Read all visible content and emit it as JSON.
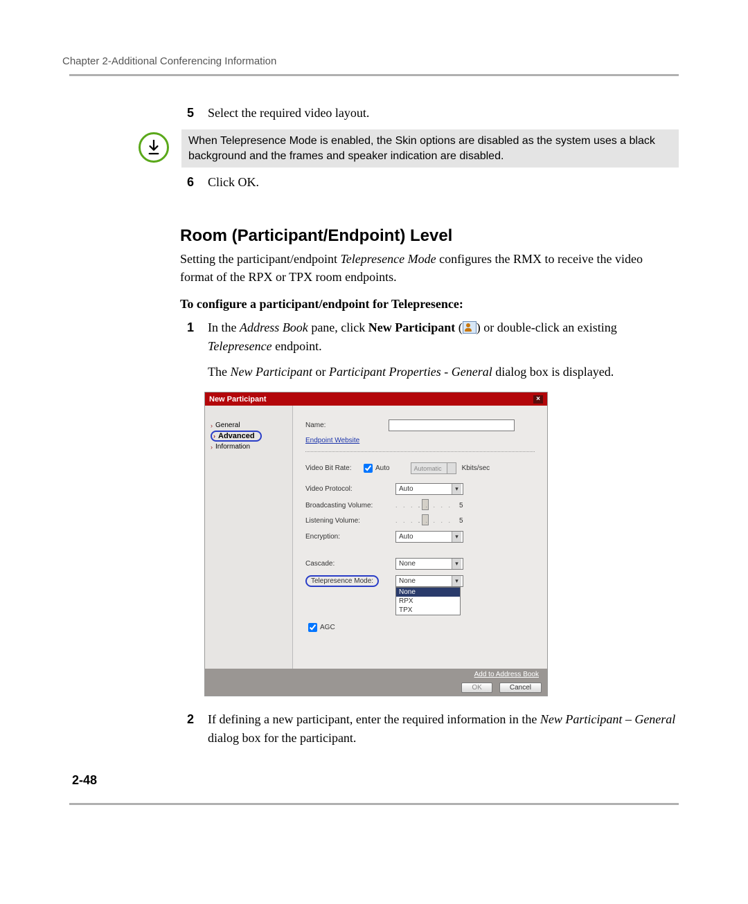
{
  "header": "Chapter 2-Additional Conferencing Information",
  "step5": {
    "num": "5",
    "text": "Select the required video layout."
  },
  "note": "When Telepresence Mode is enabled, the Skin options are disabled as the system uses a black background and the frames and speaker indication are disabled.",
  "step6": {
    "num": "6",
    "text": "Click OK."
  },
  "section_heading": "Room (Participant/Endpoint) Level",
  "intro_part1": "Setting the participant/endpoint ",
  "intro_em": "Telepresence Mode",
  "intro_part2": " configures the RMX to receive the video format of the RPX or TPX room endpoints.",
  "config_heading": "To configure a participant/endpoint for Telepresence:",
  "step1": {
    "num": "1",
    "t1": "In the ",
    "t2": "Address Book",
    "t3": " pane, click ",
    "t4": "New Participant",
    "t5": " (",
    "t6": ") or double-click an existing ",
    "t7": "Telepresence",
    "t8": " endpoint."
  },
  "result_line": {
    "t1": "The ",
    "t2": "New Participant",
    "t3": " or ",
    "t4": "Participant Properties - General",
    "t5": " dialog box is displayed."
  },
  "dialog": {
    "title": "New Participant",
    "side": {
      "general": "General",
      "advanced": "Advanced",
      "information": "Information"
    },
    "labels": {
      "name": "Name:",
      "endpoint_website": "Endpoint Website",
      "video_bit_rate": "Video Bit Rate:",
      "auto_cb": "Auto",
      "automatic": "Automatic",
      "kbits": "Kbits/sec",
      "video_protocol": "Video Protocol:",
      "broadcasting": "Broadcasting Volume:",
      "listening": "Listening Volume:",
      "encryption": "Encryption:",
      "cascade": "Cascade:",
      "telepresence": "Telepresence Mode:",
      "agc": "AGC"
    },
    "values": {
      "video_protocol": "Auto",
      "broadcast_val": "5",
      "listen_val": "5",
      "encryption": "Auto",
      "cascade": "None",
      "telepresence_selected": "None",
      "tp_options": {
        "none": "None",
        "rpx": "RPX",
        "tpx": "TPX"
      }
    },
    "footer": {
      "add_book": "Add to Address Book",
      "ok": "OK",
      "cancel": "Cancel"
    }
  },
  "step2": {
    "num": "2",
    "t1": "If defining a new participant, enter the required information in the ",
    "t2": "New Participant – General",
    "t3": " dialog box for the participant."
  },
  "page_num": "2-48"
}
